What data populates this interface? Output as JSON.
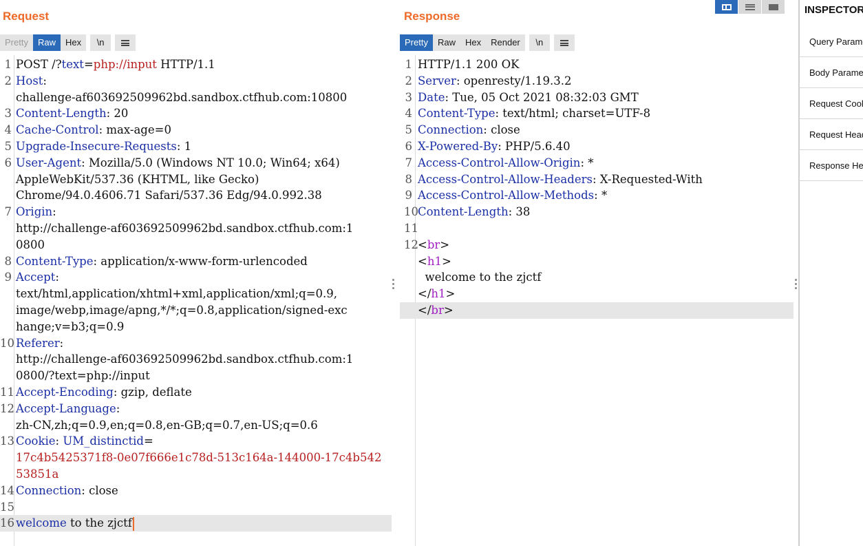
{
  "request": {
    "title": "Request",
    "tabs": [
      "Pretty",
      "Raw",
      "Hex"
    ],
    "newline_tab": "\\n",
    "active_tab": "Raw",
    "lines": [
      {
        "n": "1",
        "parts": [
          {
            "t": "POST /?"
          },
          {
            "t": "text",
            "c": "key"
          },
          {
            "t": "="
          },
          {
            "t": "php://input",
            "c": "red"
          },
          {
            "t": " HTTP/1.1"
          }
        ]
      },
      {
        "n": "2",
        "parts": [
          {
            "t": "Host",
            "c": "key"
          },
          {
            "t": ":"
          }
        ]
      },
      {
        "n": "",
        "parts": [
          {
            "t": "challenge-af603692509962bd.sandbox.ctfhub.com:10800"
          }
        ]
      },
      {
        "n": "3",
        "parts": [
          {
            "t": "Content-Length",
            "c": "key"
          },
          {
            "t": ": 20"
          }
        ]
      },
      {
        "n": "4",
        "parts": [
          {
            "t": "Cache-Control",
            "c": "key"
          },
          {
            "t": ": max-age=0"
          }
        ]
      },
      {
        "n": "5",
        "parts": [
          {
            "t": "Upgrade-Insecure-Requests",
            "c": "key"
          },
          {
            "t": ": 1"
          }
        ]
      },
      {
        "n": "6",
        "parts": [
          {
            "t": "User-Agent",
            "c": "key"
          },
          {
            "t": ": Mozilla/5.0 (Windows NT 10.0; Win64; x64)"
          }
        ]
      },
      {
        "n": "",
        "parts": [
          {
            "t": "AppleWebKit/537.36 (KHTML, like Gecko)"
          }
        ]
      },
      {
        "n": "",
        "parts": [
          {
            "t": "Chrome/94.0.4606.71 Safari/537.36 Edg/94.0.992.38"
          }
        ]
      },
      {
        "n": "7",
        "parts": [
          {
            "t": "Origin",
            "c": "key"
          },
          {
            "t": ":"
          }
        ]
      },
      {
        "n": "",
        "parts": [
          {
            "t": "http://challenge-af603692509962bd.sandbox.ctfhub.com:1"
          }
        ]
      },
      {
        "n": "",
        "parts": [
          {
            "t": "0800"
          }
        ]
      },
      {
        "n": "8",
        "parts": [
          {
            "t": "Content-Type",
            "c": "key"
          },
          {
            "t": ": application/x-www-form-urlencoded"
          }
        ]
      },
      {
        "n": "9",
        "parts": [
          {
            "t": "Accept",
            "c": "key"
          },
          {
            "t": ":"
          }
        ]
      },
      {
        "n": "",
        "parts": [
          {
            "t": "text/html,application/xhtml+xml,application/xml;q=0.9,"
          }
        ]
      },
      {
        "n": "",
        "parts": [
          {
            "t": "image/webp,image/apng,*/*;q=0.8,application/signed-exc"
          }
        ]
      },
      {
        "n": "",
        "parts": [
          {
            "t": "hange;v=b3;q=0.9"
          }
        ]
      },
      {
        "n": "10",
        "parts": [
          {
            "t": "Referer",
            "c": "key"
          },
          {
            "t": ":"
          }
        ]
      },
      {
        "n": "",
        "parts": [
          {
            "t": "http://challenge-af603692509962bd.sandbox.ctfhub.com:1"
          }
        ]
      },
      {
        "n": "",
        "parts": [
          {
            "t": "0800/?text=php://input"
          }
        ]
      },
      {
        "n": "11",
        "parts": [
          {
            "t": "Accept-Encoding",
            "c": "key"
          },
          {
            "t": ": gzip, deflate"
          }
        ]
      },
      {
        "n": "12",
        "parts": [
          {
            "t": "Accept-Language",
            "c": "key"
          },
          {
            "t": ":"
          }
        ]
      },
      {
        "n": "",
        "parts": [
          {
            "t": "zh-CN,zh;q=0.9,en;q=0.8,en-GB;q=0.7,en-US;q=0.6"
          }
        ]
      },
      {
        "n": "13",
        "parts": [
          {
            "t": "Cookie",
            "c": "key"
          },
          {
            "t": ": "
          },
          {
            "t": "UM_distinctid",
            "c": "key"
          },
          {
            "t": "="
          }
        ]
      },
      {
        "n": "",
        "parts": [
          {
            "t": "17c4b5425371f8-0e07f666e1c78d-513c164a-144000-17c4b542",
            "c": "red"
          }
        ]
      },
      {
        "n": "",
        "parts": [
          {
            "t": "53851a",
            "c": "red"
          }
        ]
      },
      {
        "n": "14",
        "parts": [
          {
            "t": "Connection",
            "c": "key"
          },
          {
            "t": ": close"
          }
        ]
      },
      {
        "n": "15",
        "parts": []
      },
      {
        "n": "16",
        "parts": [
          {
            "t": "welcome",
            "c": "key"
          },
          {
            "t": " to the zjctf"
          }
        ],
        "highlight": true,
        "caret": true
      }
    ]
  },
  "response": {
    "title": "Response",
    "tabs": [
      "Pretty",
      "Raw",
      "Hex",
      "Render"
    ],
    "newline_tab": "\\n",
    "active_tab": "Pretty",
    "lines": [
      {
        "n": "1",
        "parts": [
          {
            "t": "HTTP/1.1 200 OK"
          }
        ]
      },
      {
        "n": "2",
        "parts": [
          {
            "t": "Server",
            "c": "key"
          },
          {
            "t": ": openresty/1.19.3.2"
          }
        ]
      },
      {
        "n": "3",
        "parts": [
          {
            "t": "Date",
            "c": "key"
          },
          {
            "t": ": Tue, 05 Oct 2021 08:32:03 GMT"
          }
        ]
      },
      {
        "n": "4",
        "parts": [
          {
            "t": "Content-Type",
            "c": "key"
          },
          {
            "t": ": text/html; charset=UTF-8"
          }
        ]
      },
      {
        "n": "5",
        "parts": [
          {
            "t": "Connection",
            "c": "key"
          },
          {
            "t": ": close"
          }
        ]
      },
      {
        "n": "6",
        "parts": [
          {
            "t": "X-Powered-By",
            "c": "key"
          },
          {
            "t": ": PHP/5.6.40"
          }
        ]
      },
      {
        "n": "7",
        "parts": [
          {
            "t": "Access-Control-Allow-Origin",
            "c": "key"
          },
          {
            "t": ": *"
          }
        ]
      },
      {
        "n": "8",
        "parts": [
          {
            "t": "Access-Control-Allow-Headers",
            "c": "key"
          },
          {
            "t": ": X-Requested-With"
          }
        ]
      },
      {
        "n": "9",
        "parts": [
          {
            "t": "Access-Control-Allow-Methods",
            "c": "key"
          },
          {
            "t": ": *"
          }
        ]
      },
      {
        "n": "10",
        "parts": [
          {
            "t": "Content-Length",
            "c": "key"
          },
          {
            "t": ": 38"
          }
        ]
      },
      {
        "n": "11",
        "parts": []
      },
      {
        "n": "12",
        "parts": [
          {
            "t": "<"
          },
          {
            "t": "br",
            "c": "tag"
          },
          {
            "t": ">"
          }
        ]
      },
      {
        "n": "",
        "parts": [
          {
            "t": "<"
          },
          {
            "t": "h1",
            "c": "tag"
          },
          {
            "t": ">"
          }
        ]
      },
      {
        "n": "",
        "parts": [
          {
            "t": "  welcome to the zjctf"
          }
        ]
      },
      {
        "n": "",
        "parts": [
          {
            "t": "</"
          },
          {
            "t": "h1",
            "c": "tag"
          },
          {
            "t": ">"
          }
        ]
      },
      {
        "n": "",
        "parts": [
          {
            "t": "</"
          },
          {
            "t": "br",
            "c": "tag"
          },
          {
            "t": ">"
          }
        ],
        "highlight": true
      }
    ]
  },
  "inspector": {
    "title": "INSPECTOR",
    "items": [
      "Query Parameters",
      "Body Parameters",
      "Request Cookies",
      "Request Headers",
      "Response Headers"
    ]
  }
}
